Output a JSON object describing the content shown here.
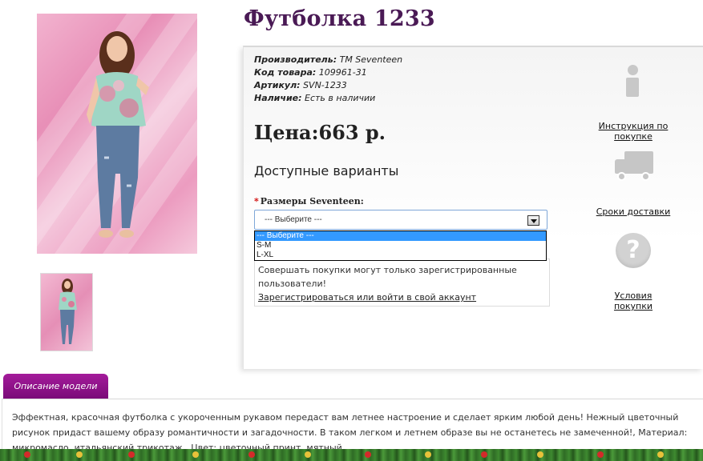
{
  "product": {
    "title": "Футболка 1233",
    "meta": [
      {
        "label": "Производитель:",
        "value": "TM Seventeen"
      },
      {
        "label": "Код товара:",
        "value": "109961-31"
      },
      {
        "label": "Артикул:",
        "value": "SVN-1233"
      },
      {
        "label": "Наличие:",
        "value": "Есть в наличии"
      }
    ],
    "price": "Цена:663 р.",
    "variants_title": "Доступные варианты",
    "size": {
      "required_mark": "*",
      "label": "Размеры Seventeen:",
      "selected": "--- Выберите ---",
      "options": [
        "--- Выберите ---",
        "S-M",
        "L-XL"
      ]
    },
    "notice": {
      "text": "Совершать покупки могут только зарегистрированные пользователи!",
      "link": "Зарегистрироваться или войти в свой аккаунт"
    }
  },
  "side_links": {
    "instructions": "Инструкция по покупке",
    "delivery": "Сроки доставки",
    "terms": "Условия покупки"
  },
  "description": {
    "tab_label": "Описание модели",
    "text": "Эффектная, красочная футболка с укороченным рукавом передаст вам летнее настроение и сделает ярким любой день! Нежный цветочный рисунок придаст вашему образу романтичности и загадочности. В таком легком и летнем образе вы не останетесь не замеченной!, Материал: микромасло, итальянский трикотаж., Цвет: цветочный принт, мятный."
  },
  "icons": {
    "info": "info-icon",
    "delivery": "truck-icon",
    "terms": "question-icon"
  },
  "colors": {
    "title": "#4a1a55",
    "tab": "#8f1489",
    "required": "#d00000",
    "selected_option": "#3399ff"
  }
}
